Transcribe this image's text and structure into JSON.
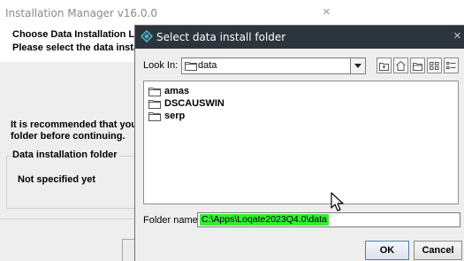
{
  "background_window": {
    "title": "Installation Manager v16.0.0",
    "close_glyph": "×",
    "header_line1": "Choose Data Installation Locatio",
    "header_line2": "Please select the data installatio",
    "recommend_line1": "It is recommended that you clos",
    "recommend_line2": "folder before continuing.",
    "group_legend": "Data installation folder",
    "folder_status": "Not specified yet"
  },
  "dialog": {
    "title": "Select data install folder",
    "title_icon": "app-diamond-icon",
    "close_glyph": "×",
    "look_in": {
      "label": "Look In:",
      "value": "data"
    },
    "toolbar": [
      {
        "name": "up-one-level",
        "icon": "up-folder-icon"
      },
      {
        "name": "home",
        "icon": "home-icon"
      },
      {
        "name": "new-folder",
        "icon": "new-folder-icon"
      },
      {
        "name": "list-view",
        "icon": "list-view-icon"
      },
      {
        "name": "details-view",
        "icon": "details-view-icon"
      }
    ],
    "files": [
      "amas",
      "DSCAUSWIN",
      "serp"
    ],
    "file_name": {
      "label": "Folder name:",
      "value": "C:\\Apps\\Loqate2023Q4.0\\data"
    },
    "buttons": {
      "ok": "OK",
      "cancel": "Cancel"
    }
  },
  "colors": {
    "dialog_titlebar": "#2c343c",
    "dialog_title_icon": "#4fb0c6",
    "selection_highlight": "#33ee33",
    "ok_border": "#4d7fb8"
  }
}
